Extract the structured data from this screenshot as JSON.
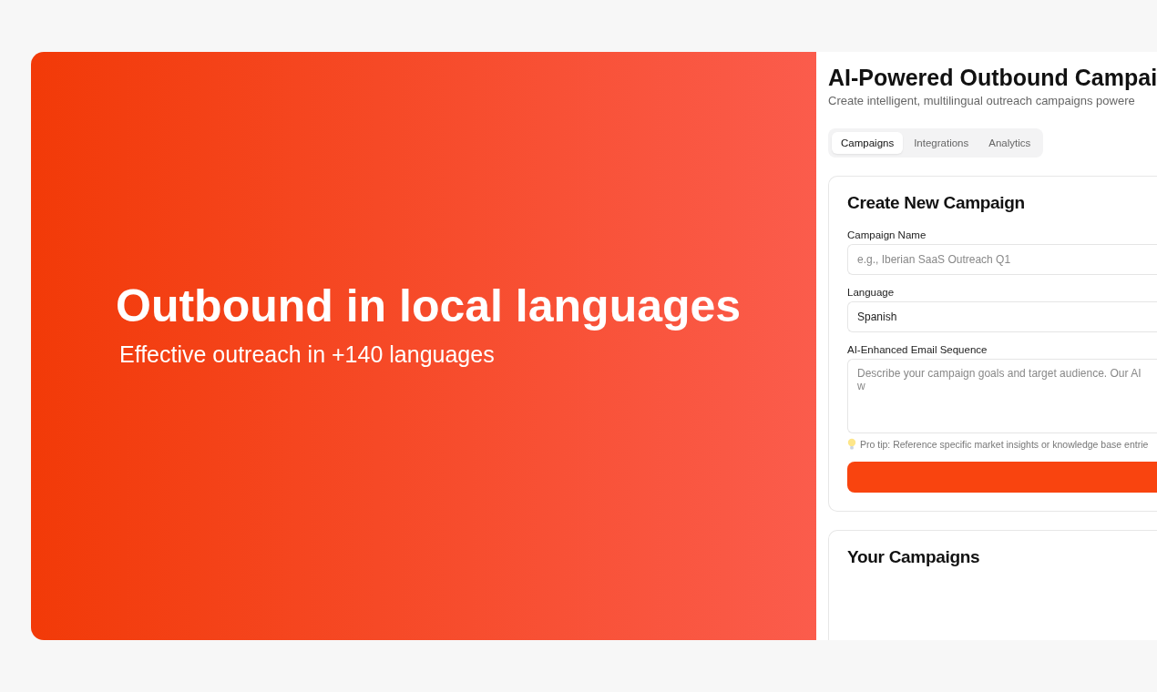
{
  "hero": {
    "title": "Outbound in local languages",
    "subtitle": "Effective outreach in +140 languages"
  },
  "app": {
    "title": "AI-Powered Outbound Campai",
    "subtitle": "Create intelligent, multilingual outreach campaigns powere",
    "tabs": [
      {
        "label": "Campaigns",
        "selected": true
      },
      {
        "label": "Integrations",
        "selected": false
      },
      {
        "label": "Analytics",
        "selected": false
      }
    ],
    "create_card": {
      "title": "Create New Campaign",
      "fields": [
        {
          "kind": "input",
          "label": "Campaign Name",
          "placeholder": "e.g., Iberian SaaS Outreach Q1"
        },
        {
          "kind": "select",
          "label": "Language",
          "value": "Spanish"
        },
        {
          "kind": "textarea",
          "label": "AI-Enhanced Email Sequence",
          "placeholder": "Describe your campaign goals and target audience. Our AI w"
        }
      ],
      "tip": "Pro tip: Reference specific market insights or knowledge base entrie"
    },
    "campaigns_card": {
      "title": "Your Campaigns"
    }
  }
}
